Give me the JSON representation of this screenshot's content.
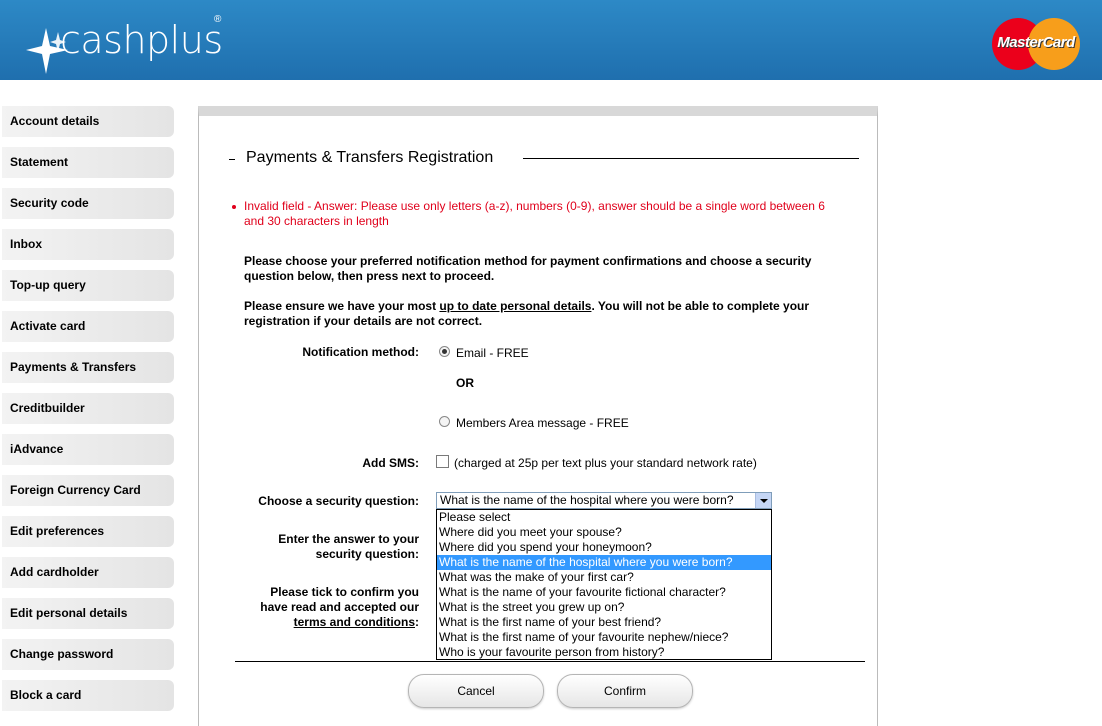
{
  "brand": {
    "name": "cashplus",
    "reg": "®",
    "card": "MasterCard"
  },
  "sidebar": {
    "items": [
      {
        "label": "Account details"
      },
      {
        "label": "Statement"
      },
      {
        "label": "Security code"
      },
      {
        "label": "Inbox"
      },
      {
        "label": "Top-up query"
      },
      {
        "label": "Activate card"
      },
      {
        "label": "Payments & Transfers"
      },
      {
        "label": "Creditbuilder"
      },
      {
        "label": "iAdvance"
      },
      {
        "label": "Foreign Currency Card"
      },
      {
        "label": "Edit preferences"
      },
      {
        "label": "Add cardholder"
      },
      {
        "label": "Edit personal details"
      },
      {
        "label": "Change password"
      },
      {
        "label": "Block a card"
      }
    ]
  },
  "main": {
    "title": "Payments & Transfers Registration",
    "error": "Invalid field - Answer: Please use only letters (a-z), numbers (0-9), answer should be a single word between 6 and 30 characters in length",
    "intro": "Please choose your preferred notification method for payment confirmations and choose a security question below, then press next to proceed.",
    "ensure_prefix": "Please ensure we have your most ",
    "ensure_link": "up to date personal details",
    "ensure_suffix": ". You will not be able to complete your registration if your details are not correct.",
    "notification_label": "Notification method:",
    "email_option": "Email - FREE",
    "or_text": "OR",
    "members_option": "Members Area message - FREE",
    "sms_label": "Add SMS:",
    "sms_text": "(charged at 25p per text plus your standard network rate)",
    "question_label": "Choose a security question:",
    "question_selected": "What is the name of the hospital where you were born?",
    "answer_label_1": "Enter the answer to your",
    "answer_label_2": "security question:",
    "tick_label_1": "Please tick to confirm you",
    "tick_label_2": "have read and accepted our",
    "tick_link": "terms and conditions",
    "tick_colon": ":",
    "questions": [
      "Please select",
      "Where did you meet your spouse?",
      "Where did you spend your honeymoon?",
      "What is the name of the hospital where you were born?",
      "What was the make of your first car?",
      "What is the name of your favourite fictional character?",
      "What is the street you grew up on?",
      "What is the first name of your best friend?",
      "What is the first name of your favourite nephew/niece?",
      "Who is your favourite person from history?"
    ],
    "cancel_label": "Cancel",
    "confirm_label": "Confirm"
  }
}
